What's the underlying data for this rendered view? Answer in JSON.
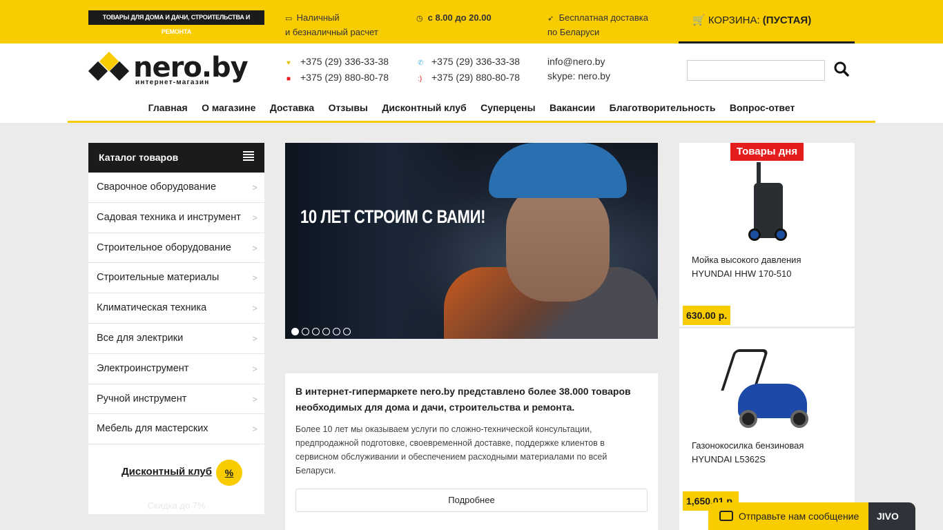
{
  "topbar": {
    "tagline": "ТОВАРЫ ДЛЯ ДОМА И ДАЧИ, СТРОИТЕЛЬСТВА И РЕМОНТА",
    "payment_line1": "Наличный",
    "payment_line2": "и безналичный расчет",
    "hours": "с 8.00 до 20.00",
    "delivery_line1": "Бесплатная доставка",
    "delivery_line2": "по Беларуси",
    "cart_label": "КОРЗИНА:",
    "cart_status": "(ПУСТАЯ)"
  },
  "header": {
    "logo_name": "nero.by",
    "logo_sub": "интернет-магазин",
    "phones_left": [
      "+375 (29) 336-33-38",
      "+375 (29) 880-80-78"
    ],
    "phones_right": [
      "+375 (29) 336-33-38",
      "+375 (29) 880-80-78"
    ],
    "email": "info@nero.by",
    "skype": "skype: nero.by",
    "search_value": ""
  },
  "nav": [
    "Главная",
    "О магазине",
    "Доставка",
    "Отзывы",
    "Дисконтный клуб",
    "Суперцены",
    "Вакансии",
    "Благотворительность",
    "Вопрос-ответ"
  ],
  "catalog": {
    "title": "Каталог товаров",
    "items": [
      "Сварочное оборудование",
      "Садовая техника и инструмент",
      "Строительное оборудование",
      "Строительные материалы",
      "Климатическая техника",
      "Все для электрики",
      "Электроинструмент",
      "Ручной инструмент",
      "Мебель для мастерских"
    ],
    "discount_label": "Дисконтный клуб",
    "discount_badge": "%",
    "discount_sub": "Скидка до 7%"
  },
  "banner": {
    "headline": "10 ЛЕТ СТРОИМ С ВАМИ!",
    "slides_total": 6,
    "active_slide": 1
  },
  "info": {
    "heading": "В интернет-гипермаркете nero.by представлено более 38.000 товаров необходимых для дома и дачи, строительства и ремонта.",
    "text": "Более 10 лет мы оказываем услуги по сложно-технической консультации, предпродажной подготовке, своевременной доставке, поддержке клиентов в сервисном обслуживании и обеспечением расходными материалами по всей Беларуси.",
    "button": "Подробнее"
  },
  "deals": {
    "tag": "Товары дня",
    "items": [
      {
        "name_line1": "Мойка высокого давления",
        "name_line2": "HYUNDAI HHW 170-510",
        "price": "630.00 р."
      },
      {
        "name_line1": "Газонокосилка бензиновая",
        "name_line2": "HYUNDAI L5362S",
        "price": "1,650.01 р."
      }
    ]
  },
  "chat": {
    "message": "Отправьте нам сообщение",
    "brand": "JIVO"
  },
  "colors": {
    "accent": "#f9cc00",
    "dark": "#1b1b1b",
    "deal_tag": "#e41e1e"
  }
}
